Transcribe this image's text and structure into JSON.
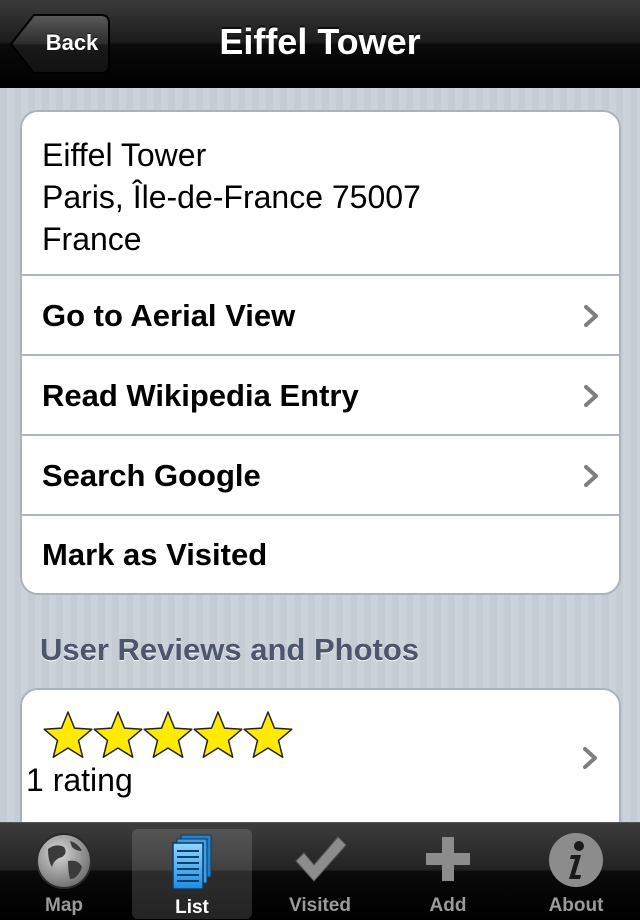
{
  "nav": {
    "back_label": "Back",
    "title": "Eiffel Tower"
  },
  "address": {
    "name": "Eiffel Tower",
    "line2": "Paris, Île-de-France 75007",
    "country": "France"
  },
  "actions": [
    {
      "label": "Go to Aerial View",
      "chevron": true
    },
    {
      "label": "Read Wikipedia Entry",
      "chevron": true
    },
    {
      "label": "Search Google",
      "chevron": true
    },
    {
      "label": "Mark as Visited",
      "chevron": false
    }
  ],
  "reviews": {
    "section_title": "User Reviews and Photos",
    "stars": 5,
    "max_stars": 5,
    "rating_text": "1 rating"
  },
  "tabbar": {
    "selected": "List",
    "tabs": [
      {
        "label": "Map",
        "icon": "globe-icon"
      },
      {
        "label": "List",
        "icon": "list-icon"
      },
      {
        "label": "Visited",
        "icon": "checkmark-icon"
      },
      {
        "label": "Add",
        "icon": "plus-icon"
      },
      {
        "label": "About",
        "icon": "info-icon"
      }
    ]
  },
  "colors": {
    "star": "#ffea00",
    "section_header": "#4c566c",
    "background": "#c5ccd4"
  }
}
